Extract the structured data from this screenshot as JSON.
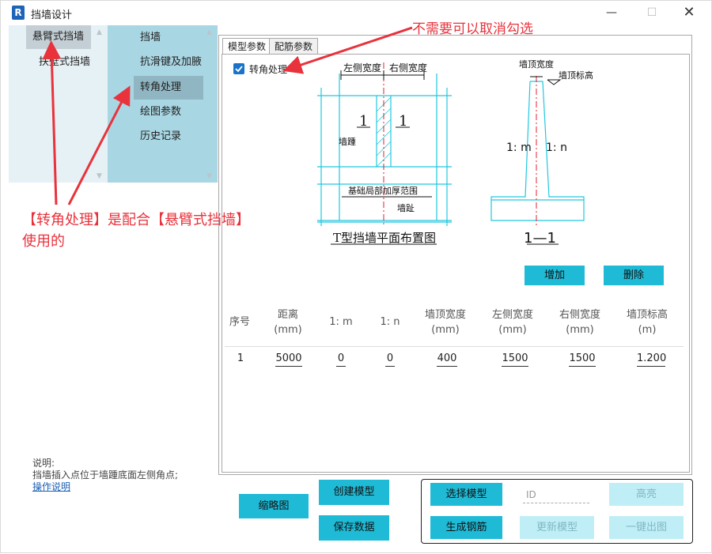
{
  "window": {
    "title": "挡墙设计",
    "min_glyph": "—",
    "max_glyph": "☐",
    "close_glyph": "✕"
  },
  "nav_primary": {
    "items": [
      {
        "label": "悬臂式挡墙",
        "selected": true
      },
      {
        "label": "扶壁式挡墙",
        "selected": false
      }
    ]
  },
  "nav_secondary": {
    "items": [
      {
        "label": "挡墙",
        "selected": false
      },
      {
        "label": "抗滑键及加腋",
        "selected": false
      },
      {
        "label": "转角处理",
        "selected": true
      },
      {
        "label": "绘图参数",
        "selected": false
      },
      {
        "label": "历史记录",
        "selected": false
      }
    ]
  },
  "notes": {
    "heading": "说明:",
    "text": "挡墙插入点位于墙踵底面左侧角点;",
    "link": "操作说明"
  },
  "tabs": [
    {
      "label": "模型参数",
      "active": true
    },
    {
      "label": "配筋参数",
      "active": false
    }
  ],
  "corner_checkbox": {
    "label": "转角处理",
    "checked": true
  },
  "plan_drawing": {
    "left_width": "左侧宽度",
    "right_width": "右侧宽度",
    "ratio_left": "1",
    "ratio_right": "1",
    "heel": "墙踵",
    "thick_range": "基础局部加厚范围",
    "toe": "墙趾",
    "caption": "T型挡墙平面布置图"
  },
  "section_drawing": {
    "top_width": "墙顶宽度",
    "top_elev": "墙顶标高",
    "slope_m": "1: m",
    "slope_n": "1: n",
    "caption": "1—1"
  },
  "actions": {
    "add": "增加",
    "delete": "删除"
  },
  "table": {
    "headers": [
      {
        "l1": "序号",
        "l2": ""
      },
      {
        "l1": "距离",
        "l2": "(mm)"
      },
      {
        "l1": "1: m",
        "l2": ""
      },
      {
        "l1": "1: n",
        "l2": ""
      },
      {
        "l1": "墙顶宽度",
        "l2": "(mm)"
      },
      {
        "l1": "左侧宽度",
        "l2": "(mm)"
      },
      {
        "l1": "右侧宽度",
        "l2": "(mm)"
      },
      {
        "l1": "墙顶标高",
        "l2": "(m)"
      }
    ],
    "rows": [
      [
        "1",
        "5000",
        "0",
        "0",
        "400",
        "1500",
        "1500",
        "1.200"
      ]
    ]
  },
  "bottom": {
    "thumbnail": "缩略图",
    "create_model": "创建模型",
    "save_data": "保存数据",
    "select_model": "选择模型",
    "id_placeholder": "ID",
    "highlight": "高亮",
    "gen_rebar": "生成钢筋",
    "update_model": "更新模型",
    "one_click_drawing": "一键出图"
  },
  "annotations": {
    "uncheck_hint": "不需要可以取消勾选",
    "usage_line1": "【转角处理】是配合【悬臂式挡墙】",
    "usage_line2": "使用的"
  },
  "colors": {
    "accent": "#1fbad6",
    "annotation": "#e8323c",
    "drawing": "#20c8e0",
    "centerline": "#e02030"
  }
}
